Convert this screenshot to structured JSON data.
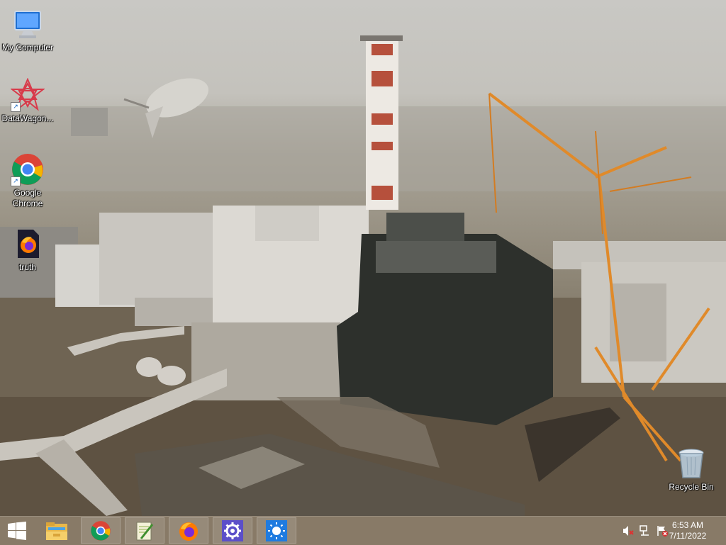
{
  "desktop": {
    "icons": [
      {
        "label": "My Computer",
        "icon": "computer-icon"
      },
      {
        "label": "DataWagon...",
        "icon": "datawagon-icon"
      },
      {
        "label": "Google Chrome",
        "icon": "chrome-icon"
      },
      {
        "label": "truth",
        "icon": "firefox-file-icon"
      },
      {
        "label": "Recycle Bin",
        "icon": "recycle-bin-icon"
      }
    ]
  },
  "taskbar": {
    "apps": [
      {
        "name": "File Explorer",
        "icon": "folder-icon"
      },
      {
        "name": "Google Chrome",
        "icon": "chrome-icon"
      },
      {
        "name": "Notepad++",
        "icon": "notepad-icon"
      },
      {
        "name": "Firefox",
        "icon": "firefox-icon"
      },
      {
        "name": "Settings",
        "icon": "gear-icon"
      },
      {
        "name": "Weather",
        "icon": "sun-icon"
      }
    ],
    "clock": {
      "time": "6:53 AM",
      "date": "7/11/2022"
    }
  },
  "colors": {
    "taskbar": "#78684f",
    "start_logo": "#ffffff",
    "settings_tile": "#5b4fc9",
    "weather_tile": "#1e7be0"
  }
}
